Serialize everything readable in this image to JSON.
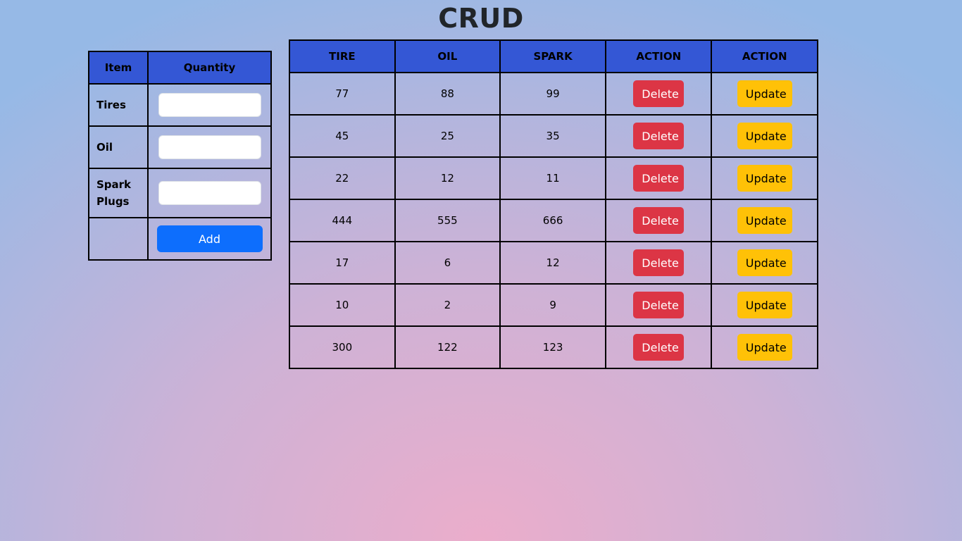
{
  "title": "CRUD",
  "form": {
    "headers": [
      "Item",
      "Quantity"
    ],
    "rows": [
      {
        "label": "Tires",
        "value": ""
      },
      {
        "label": "Oil",
        "value": ""
      },
      {
        "label": "Spark Plugs",
        "value": ""
      }
    ],
    "add_label": "Add"
  },
  "table": {
    "headers": [
      "TIRE",
      "OIL",
      "SPARK",
      "ACTION",
      "ACTION"
    ],
    "delete_label": "Delete",
    "update_label": "Update",
    "rows": [
      [
        "77",
        "88",
        "99"
      ],
      [
        "45",
        "25",
        "35"
      ],
      [
        "22",
        "12",
        "11"
      ],
      [
        "444",
        "555",
        "666"
      ],
      [
        "17",
        "6",
        "12"
      ],
      [
        "10",
        "2",
        "9"
      ],
      [
        "300",
        "122",
        "123"
      ]
    ]
  },
  "colors": {
    "header": "#3457d5",
    "add": "#0d6efd",
    "delete": "#dc3545",
    "update": "#ffc107"
  }
}
